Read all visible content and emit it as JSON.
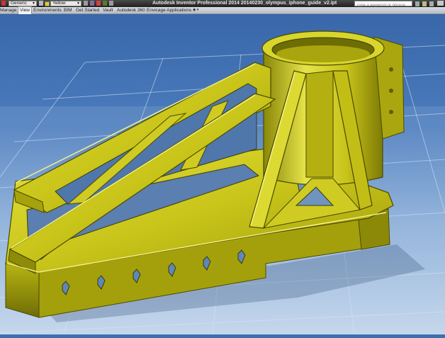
{
  "window": {
    "title": "Autodesk Inventor Professional 2014     20140230_olympus_iphone_guide_v2.ipt"
  },
  "quick_access": {
    "appearance_select": "Generic",
    "color_select": "Yellow"
  },
  "help_search": {
    "placeholder": "Type a keyword or phrase"
  },
  "ribbon_tabs": [
    "Manage",
    "View",
    "Environments",
    "BIM",
    "Get Started",
    "Vault",
    "Autodesk 360",
    "Envicage Applications"
  ],
  "active_tab": "View",
  "colors": {
    "part": "#c8c416",
    "part_dark": "#6c6a07",
    "part_light": "#eae864",
    "background_top": "#3a6aab",
    "background_bottom": "#b7cde6",
    "grid": "#cfe2f7"
  },
  "icons": {
    "window_controls": [
      "minimize-icon",
      "restore-icon",
      "close-icon"
    ],
    "tab_extra": "chevron-down-icon"
  }
}
